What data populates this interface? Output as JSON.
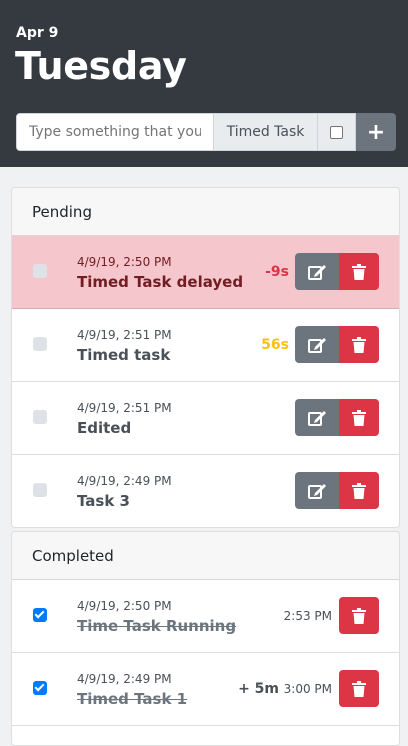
{
  "header": {
    "date": "Apr 9",
    "day": "Tuesday"
  },
  "input": {
    "placeholder": "Type something that you need to do",
    "timed_label": "Timed Task",
    "add_label": "+"
  },
  "pending": {
    "title": "Pending",
    "items": [
      {
        "time": "4/9/19, 2:50 PM",
        "title": "Timed Task delayed",
        "countdown": "-9s",
        "state": "overdue"
      },
      {
        "time": "4/9/19, 2:51 PM",
        "title": "Timed task",
        "countdown": "56s",
        "state": "soon"
      },
      {
        "time": "4/9/19, 2:51 PM",
        "title": "Edited",
        "countdown": "",
        "state": "normal"
      },
      {
        "time": "4/9/19, 2:49 PM",
        "title": "Task 3",
        "countdown": "",
        "state": "normal"
      }
    ]
  },
  "completed": {
    "title": "Completed",
    "items": [
      {
        "time": "4/9/19, 2:50 PM",
        "title": "Time Task Running",
        "extra": "",
        "done_at": "2:53 PM"
      },
      {
        "time": "4/9/19, 2:49 PM",
        "title": "Timed Task 1",
        "extra": "+ 5m",
        "done_at": "3:00 PM"
      }
    ]
  },
  "colors": {
    "header_bg": "#343a40",
    "overdue": "#dc3545",
    "soon": "#ffc107",
    "danger_row": "#f5c6cb",
    "check_blue": "#007bff"
  },
  "icons": {
    "edit": "edit-icon",
    "delete": "trash-icon",
    "add": "plus-icon"
  }
}
